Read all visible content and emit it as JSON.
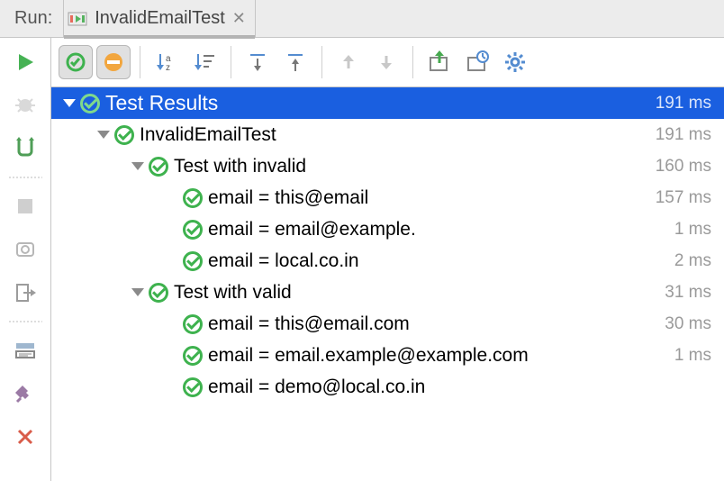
{
  "titlebar": {
    "run_label": "Run:",
    "tab_title": "InvalidEmailTest"
  },
  "tree": {
    "root": {
      "label": "Test Results",
      "duration": "191 ms"
    },
    "suite": {
      "label": "InvalidEmailTest",
      "duration": "191 ms"
    },
    "group_invalid": {
      "label": "Test with invalid",
      "duration": "160 ms"
    },
    "invalid": [
      {
        "label": "email = this@email",
        "duration": "157 ms"
      },
      {
        "label": "email = email@example.",
        "duration": "1 ms"
      },
      {
        "label": "email = local.co.in",
        "duration": "2 ms"
      }
    ],
    "group_valid": {
      "label": "Test with valid",
      "duration": "31 ms"
    },
    "valid": [
      {
        "label": "email = this@email.com",
        "duration": "30 ms"
      },
      {
        "label": "email = email.example@example.com",
        "duration": "1 ms"
      },
      {
        "label": "email = demo@local.co.in",
        "duration": ""
      }
    ]
  }
}
